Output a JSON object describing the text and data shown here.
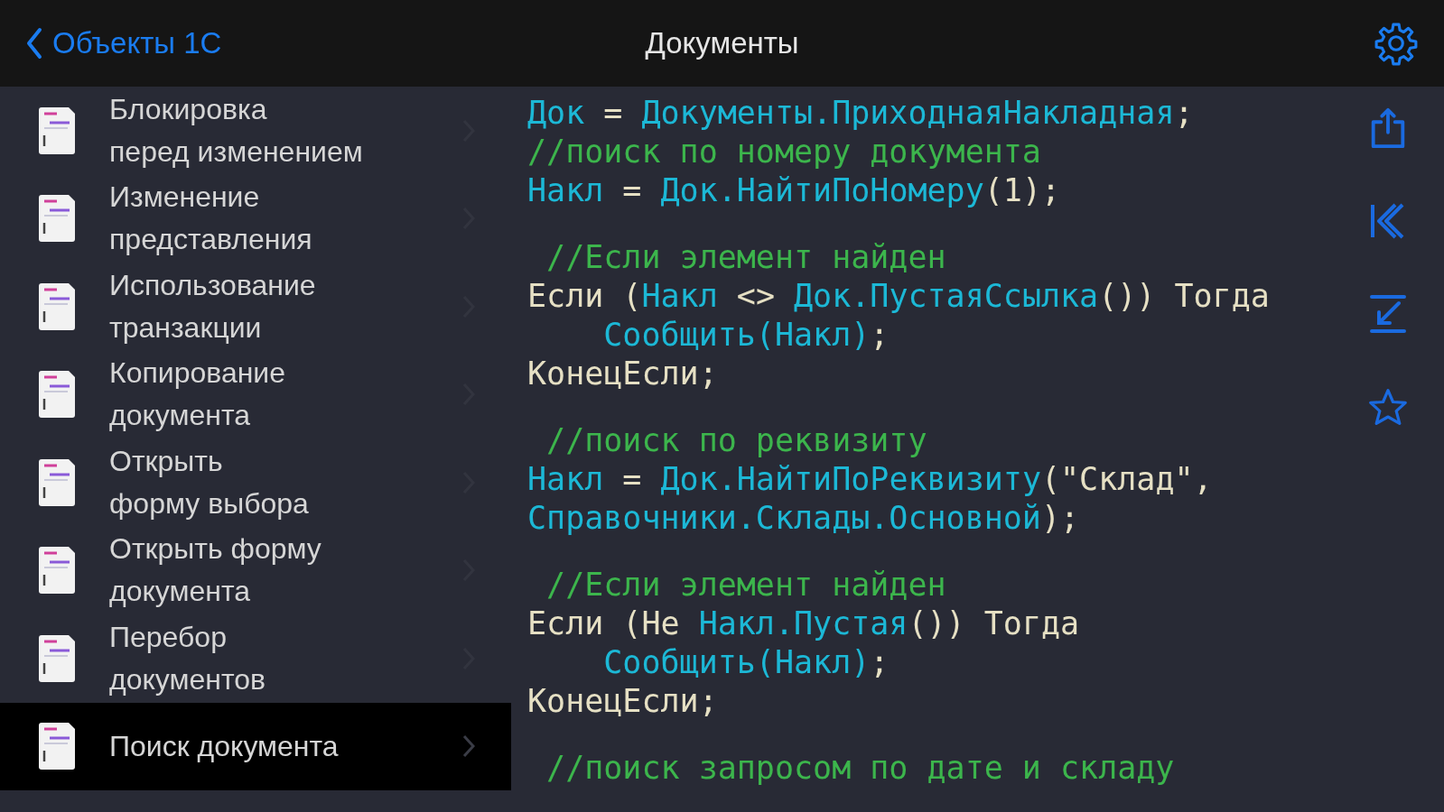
{
  "nav_bar": {
    "back_label": "Объекты 1С",
    "title": "Документы"
  },
  "sidebar": {
    "items": [
      {
        "label": "Блокировка\nперед изменением",
        "selected": false
      },
      {
        "label": "Изменение\nпредставления",
        "selected": false
      },
      {
        "label": "Использование\nтранзакции",
        "selected": false
      },
      {
        "label": "Копирование\nдокумента",
        "selected": false
      },
      {
        "label": "Открыть\nформу выбора",
        "selected": false
      },
      {
        "label": "Открыть форму\nдокумента",
        "selected": false
      },
      {
        "label": "Перебор\nдокументов",
        "selected": false
      },
      {
        "label": "Поиск документа",
        "selected": true
      }
    ]
  },
  "code": {
    "lines": [
      {
        "kind": "code",
        "tokens": [
          {
            "text": "Док",
            "kind": "id"
          },
          {
            "text": " = ",
            "kind": "kw"
          },
          {
            "text": "Документы.ПриходнаяНакладная",
            "kind": "id"
          },
          {
            "text": ";",
            "kind": "kw"
          }
        ]
      },
      {
        "kind": "code",
        "tokens": [
          {
            "text": "//поиск по номеру документа",
            "kind": "cm"
          }
        ]
      },
      {
        "kind": "code",
        "tokens": [
          {
            "text": "Накл",
            "kind": "id"
          },
          {
            "text": " = ",
            "kind": "kw"
          },
          {
            "text": "Док.НайтиПоНомеру",
            "kind": "id"
          },
          {
            "text": "(1);",
            "kind": "kw"
          }
        ]
      },
      {
        "kind": "blank"
      },
      {
        "kind": "code",
        "tokens": [
          {
            "text": " //Если элемент найден",
            "kind": "cm"
          }
        ]
      },
      {
        "kind": "code",
        "tokens": [
          {
            "text": "Если (",
            "kind": "kw"
          },
          {
            "text": "Накл",
            "kind": "id"
          },
          {
            "text": " <> ",
            "kind": "kw"
          },
          {
            "text": "Док.ПустаяСсылка",
            "kind": "id"
          },
          {
            "text": "()) Тогда",
            "kind": "kw"
          }
        ]
      },
      {
        "kind": "code",
        "indented": true,
        "tokens": [
          {
            "text": "Сообщить(Накл)",
            "kind": "id"
          },
          {
            "text": ";",
            "kind": "kw"
          }
        ]
      },
      {
        "kind": "code",
        "tokens": [
          {
            "text": "КонецЕсли;",
            "kind": "kw"
          }
        ]
      },
      {
        "kind": "blank"
      },
      {
        "kind": "code",
        "tokens": [
          {
            "text": " //поиск по реквизиту",
            "kind": "cm"
          }
        ]
      },
      {
        "kind": "code",
        "tokens": [
          {
            "text": "Накл",
            "kind": "id"
          },
          {
            "text": " = ",
            "kind": "kw"
          },
          {
            "text": "Док.НайтиПоРеквизиту",
            "kind": "id"
          },
          {
            "text": "(\"Склад\",",
            "kind": "kw"
          }
        ]
      },
      {
        "kind": "code",
        "tokens": [
          {
            "text": "Справочники.Склады.Основной",
            "kind": "id"
          },
          {
            "text": ");",
            "kind": "kw"
          }
        ]
      },
      {
        "kind": "blank"
      },
      {
        "kind": "code",
        "tokens": [
          {
            "text": " //Если элемент найден",
            "kind": "cm"
          }
        ]
      },
      {
        "kind": "code",
        "tokens": [
          {
            "text": "Если (Не ",
            "kind": "kw"
          },
          {
            "text": "Накл.Пустая",
            "kind": "id"
          },
          {
            "text": "()) Тогда",
            "kind": "kw"
          }
        ]
      },
      {
        "kind": "code",
        "indented": true,
        "tokens": [
          {
            "text": "Сообщить(Накл)",
            "kind": "id"
          },
          {
            "text": ";",
            "kind": "kw"
          }
        ]
      },
      {
        "kind": "code",
        "tokens": [
          {
            "text": "КонецЕсли;",
            "kind": "kw"
          }
        ]
      },
      {
        "kind": "blank"
      },
      {
        "kind": "code",
        "tokens": [
          {
            "text": " //поиск запросом по дате и складу",
            "kind": "cm"
          }
        ]
      }
    ]
  }
}
